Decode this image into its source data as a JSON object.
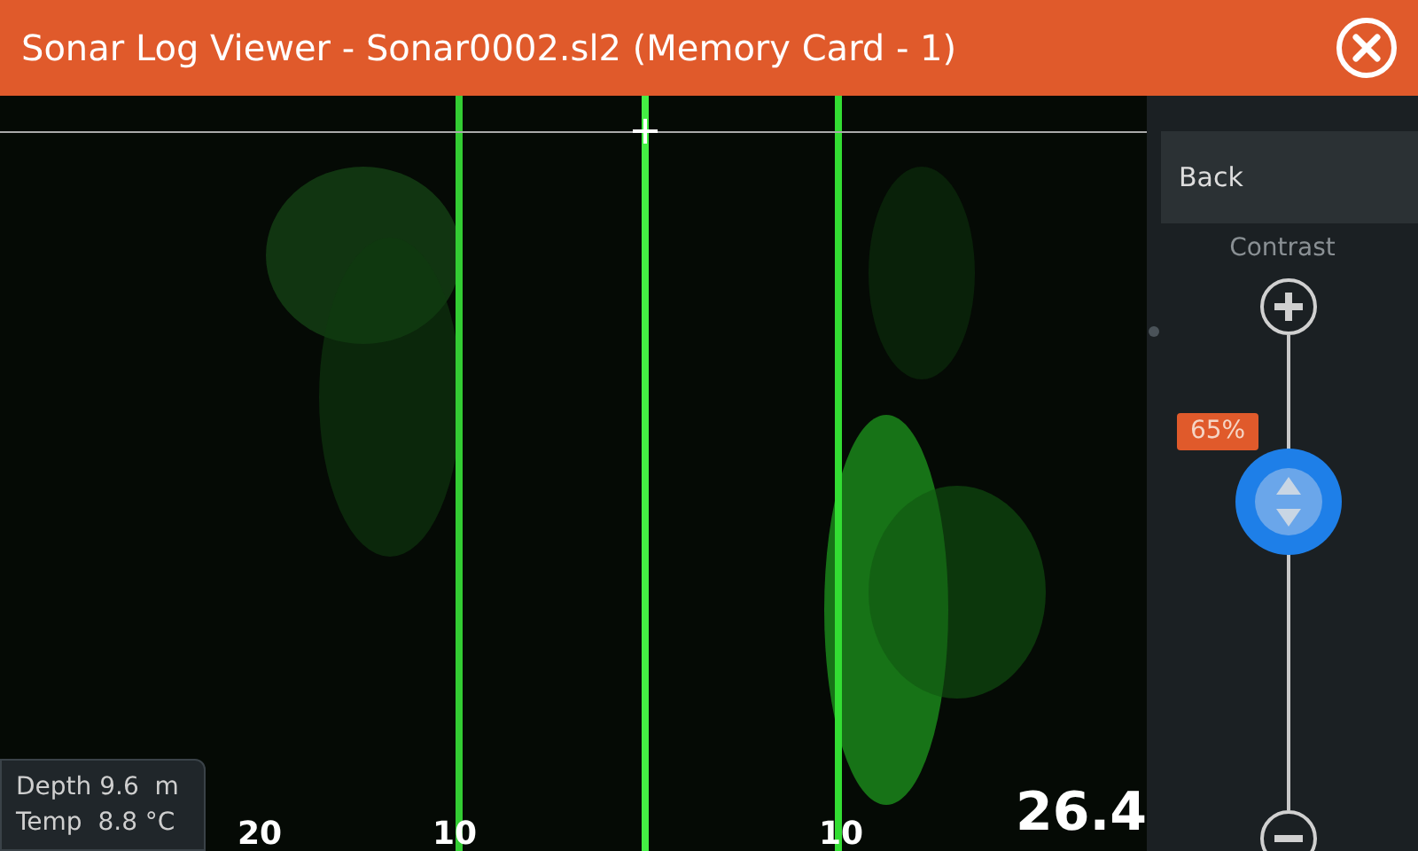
{
  "window": {
    "title": "Sonar Log Viewer - Sonar0002.sl2 (Memory Card - 1)"
  },
  "sonar": {
    "range_labels": [
      "20",
      "10",
      "10"
    ],
    "depth_reading": "26.4",
    "info": {
      "depth": "Depth 9.6  m",
      "temp": "Temp  8.8 °C"
    }
  },
  "panel": {
    "back": "Back",
    "contrast": {
      "label": "Contrast",
      "level": 0.65,
      "reading": "65%"
    }
  }
}
